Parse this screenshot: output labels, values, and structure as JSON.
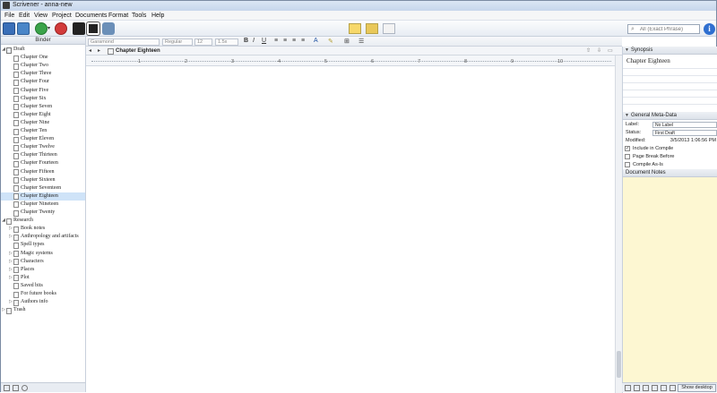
{
  "window": {
    "title": "Scrivener - anna-new"
  },
  "menu": [
    "File",
    "Edit",
    "View",
    "Project",
    "Documents",
    "Format",
    "Tools",
    "Help"
  ],
  "toolbar": {
    "icons": [
      "binder-toggle-icon",
      "collections-icon",
      "add-icon",
      "add-menu-chevron-icon",
      "delete-icon",
      "compose-icon",
      "quickref-icon",
      "compile-icon"
    ],
    "view_modes": [
      "document-view-icon",
      "corkboard-view-icon",
      "outline-view-icon"
    ],
    "search_placeholder": "All (Exact Phrase)",
    "info_label": "i"
  },
  "binder": {
    "header": "Binder",
    "items": [
      {
        "label": "Draft",
        "level": 0,
        "type": "draft",
        "expanded": true
      },
      {
        "label": "Chapter One",
        "level": 1,
        "type": "doc"
      },
      {
        "label": "Chapter Two",
        "level": 1,
        "type": "doc"
      },
      {
        "label": "Chapter Three",
        "level": 1,
        "type": "doc"
      },
      {
        "label": "Chapter Four",
        "level": 1,
        "type": "doc"
      },
      {
        "label": "Chapter Five",
        "level": 1,
        "type": "doc"
      },
      {
        "label": "Chapter Six",
        "level": 1,
        "type": "doc"
      },
      {
        "label": "Chapter Seven",
        "level": 1,
        "type": "doc"
      },
      {
        "label": "Chapter Eight",
        "level": 1,
        "type": "doc"
      },
      {
        "label": "Chapter Nine",
        "level": 1,
        "type": "doc"
      },
      {
        "label": "Chapter Ten",
        "level": 1,
        "type": "doc"
      },
      {
        "label": "Chapter Eleven",
        "level": 1,
        "type": "doc"
      },
      {
        "label": "Chapter Twelve",
        "level": 1,
        "type": "doc"
      },
      {
        "label": "Chapter Thirteen",
        "level": 1,
        "type": "doc"
      },
      {
        "label": "Chapter Fourteen",
        "level": 1,
        "type": "doc"
      },
      {
        "label": "Chapter Fifteen",
        "level": 1,
        "type": "doc"
      },
      {
        "label": "Chapter Sixteen",
        "level": 1,
        "type": "doc"
      },
      {
        "label": "Chapter Seventeen",
        "level": 1,
        "type": "doc"
      },
      {
        "label": "Chapter Eighteen",
        "level": 1,
        "type": "doc",
        "selected": true
      },
      {
        "label": "Chapter Nineteen",
        "level": 1,
        "type": "doc"
      },
      {
        "label": "Chapter Twenty",
        "level": 1,
        "type": "doc"
      },
      {
        "label": "Research",
        "level": 0,
        "type": "folder",
        "expanded": true
      },
      {
        "label": "Book notes",
        "level": 1,
        "type": "folder",
        "collapsed": true
      },
      {
        "label": "Anthropology and artifacts",
        "level": 1,
        "type": "folder",
        "collapsed": true
      },
      {
        "label": "Spell types",
        "level": 1,
        "type": "doc"
      },
      {
        "label": "Magic systems",
        "level": 1,
        "type": "folder",
        "collapsed": true
      },
      {
        "label": "Characters",
        "level": 1,
        "type": "folder",
        "collapsed": true
      },
      {
        "label": "Places",
        "level": 1,
        "type": "folder",
        "collapsed": true
      },
      {
        "label": "Plot",
        "level": 1,
        "type": "folder",
        "collapsed": true
      },
      {
        "label": "Saved bits",
        "level": 1,
        "type": "doc"
      },
      {
        "label": "For future books",
        "level": 1,
        "type": "doc"
      },
      {
        "label": "Authors info",
        "level": 1,
        "type": "folder",
        "collapsed": true
      },
      {
        "label": "Trash",
        "level": 0,
        "type": "folder",
        "collapsed": true
      }
    ]
  },
  "format_bar": {
    "font": "Garamond",
    "style": "Regular",
    "size": "12",
    "line_spacing": "1.5x",
    "buttons": [
      "B",
      "I",
      "U"
    ]
  },
  "editor": {
    "nav_back": "◂",
    "nav_forward": "▸",
    "doc_title": "Chapter Eighteen",
    "ruler_ticks": [
      "1",
      "2",
      "3",
      "4",
      "5",
      "6",
      "7",
      "8",
      "9",
      "10"
    ],
    "body_text": ""
  },
  "inspector": {
    "synopsis_header": "Synopsis",
    "synopsis_text": "Chapter Eighteen",
    "meta_header": "General Meta-Data",
    "label_key": "Label:",
    "label_value": "No Label",
    "status_key": "Status:",
    "status_value": "First Draft",
    "modified_key": "Modified:",
    "modified_value": "3/5/2013 1:06:56 PM",
    "include_in_compile": "Include in Compile",
    "page_break_before": "Page Break Before",
    "compile_as_is": "Compile As-Is",
    "notes_header": "Document Notes",
    "show_desktop": "Show desktop"
  }
}
